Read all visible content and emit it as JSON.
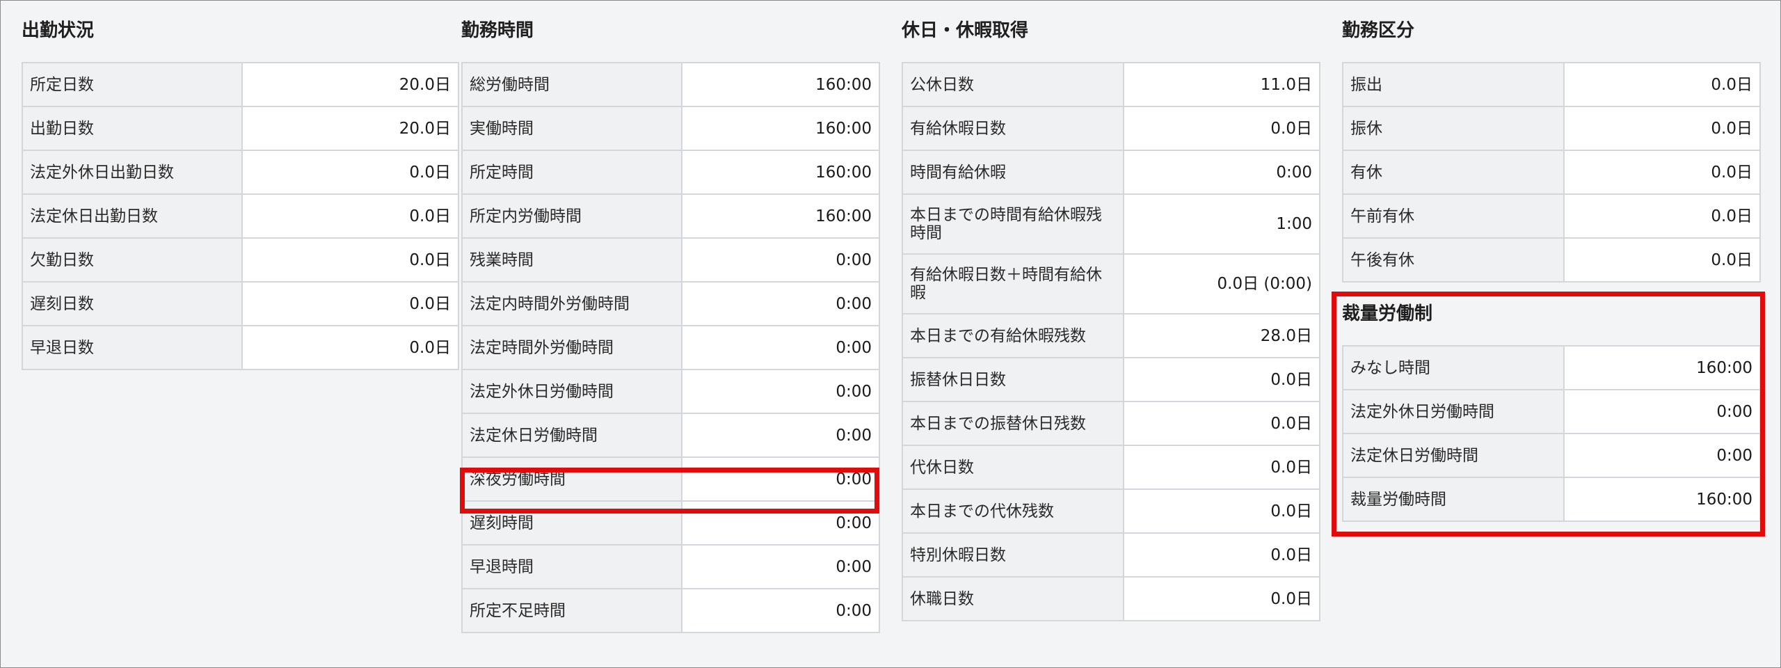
{
  "attendance": {
    "title": "出勤状況",
    "rows": [
      {
        "label": "所定日数",
        "value": "20.0日"
      },
      {
        "label": "出勤日数",
        "value": "20.0日"
      },
      {
        "label": "法定外休日出勤日数",
        "value": "0.0日"
      },
      {
        "label": "法定休日出勤日数",
        "value": "0.0日"
      },
      {
        "label": "欠勤日数",
        "value": "0.0日"
      },
      {
        "label": "遅刻日数",
        "value": "0.0日"
      },
      {
        "label": "早退日数",
        "value": "0.0日"
      }
    ]
  },
  "work_hours": {
    "title": "勤務時間",
    "rows": [
      {
        "label": "総労働時間",
        "value": "160:00"
      },
      {
        "label": "実働時間",
        "value": "160:00"
      },
      {
        "label": "所定時間",
        "value": "160:00"
      },
      {
        "label": "所定内労働時間",
        "value": "160:00"
      },
      {
        "label": "残業時間",
        "value": "0:00"
      },
      {
        "label": "法定内時間外労働時間",
        "value": "0:00"
      },
      {
        "label": "法定時間外労働時間",
        "value": "0:00"
      },
      {
        "label": "法定外休日労働時間",
        "value": "0:00"
      },
      {
        "label": "法定休日労働時間",
        "value": "0:00"
      },
      {
        "label": "深夜労働時間",
        "value": "0:00"
      },
      {
        "label": "遅刻時間",
        "value": "0:00"
      },
      {
        "label": "早退時間",
        "value": "0:00"
      },
      {
        "label": "所定不足時間",
        "value": "0:00"
      }
    ]
  },
  "leave": {
    "title": "休日・休暇取得",
    "rows": [
      {
        "label": "公休日数",
        "value": "11.0日"
      },
      {
        "label": "有給休暇日数",
        "value": "0.0日"
      },
      {
        "label": "時間有給休暇",
        "value": "0:00"
      },
      {
        "label": "本日までの時間有給休暇残時間",
        "value": "1:00"
      },
      {
        "label": "有給休暇日数＋時間有給休暇",
        "value": "0.0日 (0:00)"
      },
      {
        "label": "本日までの有給休暇残数",
        "value": "28.0日"
      },
      {
        "label": "振替休日日数",
        "value": "0.0日"
      },
      {
        "label": "本日までの振替休日残数",
        "value": "0.0日"
      },
      {
        "label": "代休日数",
        "value": "0.0日"
      },
      {
        "label": "本日までの代休残数",
        "value": "0.0日"
      },
      {
        "label": "特別休暇日数",
        "value": "0.0日"
      },
      {
        "label": "休職日数",
        "value": "0.0日"
      }
    ]
  },
  "work_category": {
    "title": "勤務区分",
    "rows": [
      {
        "label": "振出",
        "value": "0.0日"
      },
      {
        "label": "振休",
        "value": "0.0日"
      },
      {
        "label": "有休",
        "value": "0.0日"
      },
      {
        "label": "午前有休",
        "value": "0.0日"
      },
      {
        "label": "午後有休",
        "value": "0.0日"
      }
    ]
  },
  "discretionary": {
    "title": "裁量労働制",
    "rows": [
      {
        "label": "みなし時間",
        "value": "160:00"
      },
      {
        "label": "法定外休日労働時間",
        "value": "0:00"
      },
      {
        "label": "法定休日労働時間",
        "value": "0:00"
      },
      {
        "label": "裁量労働時間",
        "value": "160:00"
      }
    ]
  },
  "colors": {
    "highlight": "#e20b0b",
    "label_bg": "#f0f1f3",
    "value_bg": "#ffffff",
    "border": "#d3d7dc"
  }
}
